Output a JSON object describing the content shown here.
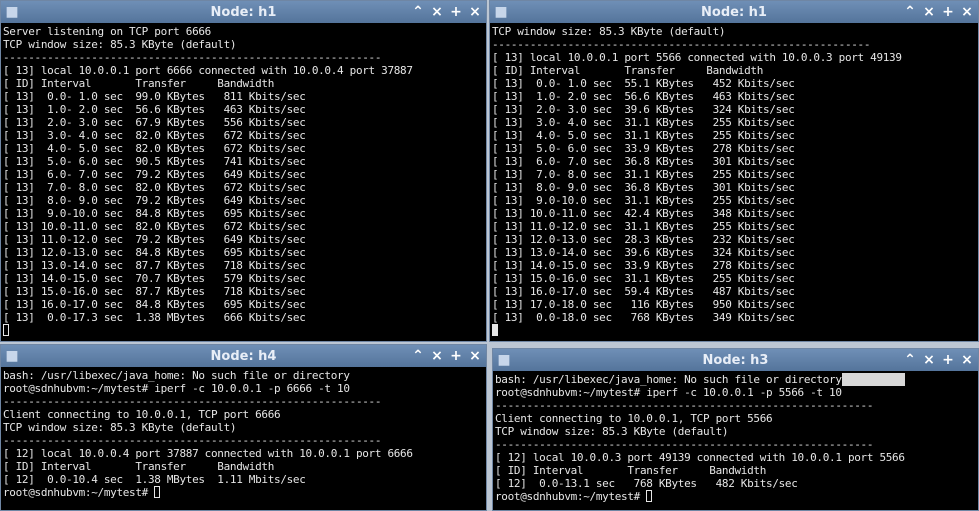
{
  "windows": {
    "tl": {
      "title": "Node: h1",
      "lines": [
        "Server listening on TCP port 6666",
        "TCP window size: 85.3 KByte (default)",
        "------------------------------------------------------------",
        "[ 13] local 10.0.0.1 port 6666 connected with 10.0.0.4 port 37887",
        "[ ID] Interval       Transfer     Bandwidth",
        "[ 13]  0.0- 1.0 sec  99.0 KBytes   811 Kbits/sec",
        "[ 13]  1.0- 2.0 sec  56.6 KBytes   463 Kbits/sec",
        "[ 13]  2.0- 3.0 sec  67.9 KBytes   556 Kbits/sec",
        "[ 13]  3.0- 4.0 sec  82.0 KBytes   672 Kbits/sec",
        "[ 13]  4.0- 5.0 sec  82.0 KBytes   672 Kbits/sec",
        "[ 13]  5.0- 6.0 sec  90.5 KBytes   741 Kbits/sec",
        "[ 13]  6.0- 7.0 sec  79.2 KBytes   649 Kbits/sec",
        "[ 13]  7.0- 8.0 sec  82.0 KBytes   672 Kbits/sec",
        "[ 13]  8.0- 9.0 sec  79.2 KBytes   649 Kbits/sec",
        "[ 13]  9.0-10.0 sec  84.8 KBytes   695 Kbits/sec",
        "[ 13] 10.0-11.0 sec  82.0 KBytes   672 Kbits/sec",
        "[ 13] 11.0-12.0 sec  79.2 KBytes   649 Kbits/sec",
        "[ 13] 12.0-13.0 sec  84.8 KBytes   695 Kbits/sec",
        "[ 13] 13.0-14.0 sec  87.7 KBytes   718 Kbits/sec",
        "[ 13] 14.0-15.0 sec  70.7 KBytes   579 Kbits/sec",
        "[ 13] 15.0-16.0 sec  87.7 KBytes   718 Kbits/sec",
        "[ 13] 16.0-17.0 sec  84.8 KBytes   695 Kbits/sec",
        "[ 13]  0.0-17.3 sec  1.38 MBytes   666 Kbits/sec"
      ]
    },
    "tr": {
      "title": "Node: h1",
      "lines": [
        "TCP window size: 85.3 KByte (default)",
        "------------------------------------------------------------",
        "[ 13] local 10.0.0.1 port 5566 connected with 10.0.0.3 port 49139",
        "[ ID] Interval       Transfer     Bandwidth",
        "[ 13]  0.0- 1.0 sec  55.1 KBytes   452 Kbits/sec",
        "[ 13]  1.0- 2.0 sec  56.6 KBytes   463 Kbits/sec",
        "[ 13]  2.0- 3.0 sec  39.6 KBytes   324 Kbits/sec",
        "[ 13]  3.0- 4.0 sec  31.1 KBytes   255 Kbits/sec",
        "[ 13]  4.0- 5.0 sec  31.1 KBytes   255 Kbits/sec",
        "[ 13]  5.0- 6.0 sec  33.9 KBytes   278 Kbits/sec",
        "[ 13]  6.0- 7.0 sec  36.8 KBytes   301 Kbits/sec",
        "[ 13]  7.0- 8.0 sec  31.1 KBytes   255 Kbits/sec",
        "[ 13]  8.0- 9.0 sec  36.8 KBytes   301 Kbits/sec",
        "[ 13]  9.0-10.0 sec  31.1 KBytes   255 Kbits/sec",
        "[ 13] 10.0-11.0 sec  42.4 KBytes   348 Kbits/sec",
        "[ 13] 11.0-12.0 sec  31.1 KBytes   255 Kbits/sec",
        "[ 13] 12.0-13.0 sec  28.3 KBytes   232 Kbits/sec",
        "[ 13] 13.0-14.0 sec  39.6 KBytes   324 Kbits/sec",
        "[ 13] 14.0-15.0 sec  33.9 KBytes   278 Kbits/sec",
        "[ 13] 15.0-16.0 sec  31.1 KBytes   255 Kbits/sec",
        "[ 13] 16.0-17.0 sec  59.4 KBytes   487 Kbits/sec",
        "[ 13] 17.0-18.0 sec   116 KBytes   950 Kbits/sec",
        "[ 13]  0.0-18.0 sec   768 KBytes   349 Kbits/sec"
      ]
    },
    "bl": {
      "title": "Node: h4",
      "lines": [
        "bash: /usr/libexec/java_home: No such file or directory",
        "root@sdnhubvm:~/mytest# iperf -c 10.0.0.1 -p 6666 -t 10",
        "------------------------------------------------------------",
        "Client connecting to 10.0.0.1, TCP port 6666",
        "TCP window size: 85.3 KByte (default)",
        "------------------------------------------------------------",
        "[ 12] local 10.0.0.4 port 37887 connected with 10.0.0.1 port 6666",
        "[ ID] Interval       Transfer     Bandwidth",
        "[ 12]  0.0-10.4 sec  1.38 MBytes  1.11 Mbits/sec"
      ],
      "prompt": "root@sdnhubvm:~/mytest# "
    },
    "br": {
      "title": "Node: h3",
      "lines": [
        "bash: /usr/libexec/java_home: No such file or directory",
        "root@sdnhubvm:~/mytest# iperf -c 10.0.0.1 -p 5566 -t 10",
        "------------------------------------------------------------",
        "Client connecting to 10.0.0.1, TCP port 5566",
        "TCP window size: 85.3 KByte (default)",
        "------------------------------------------------------------",
        "[ 12] local 10.0.0.3 port 49139 connected with 10.0.0.1 port 5566",
        "[ ID] Interval       Transfer     Bandwidth",
        "[ 12]  0.0-13.1 sec   768 KBytes   482 Kbits/sec"
      ],
      "prompt": "root@sdnhubvm:~/mytest# "
    }
  },
  "icons": {
    "window": "terminal-icon",
    "minimize": "chevron-up-icon",
    "maximize": "chevron-up-icon",
    "close": "close-icon",
    "add": "plus-icon"
  },
  "colors": {
    "titlebar": "#5f7fa6",
    "terminal_bg": "#000000",
    "terminal_fg": "#e6e6e6"
  }
}
